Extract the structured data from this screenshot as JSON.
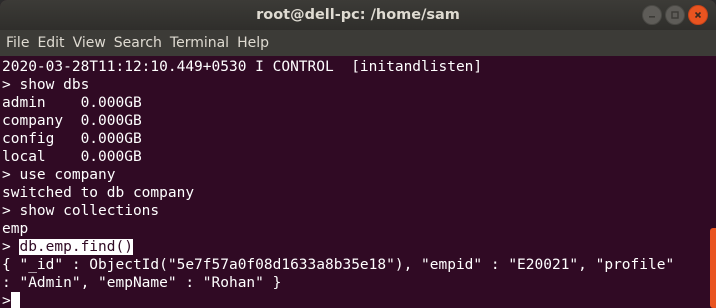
{
  "window": {
    "title": "root@dell-pc: /home/sam",
    "buttons": {
      "minimize": "minimize-icon",
      "maximize": "maximize-icon",
      "close": "close-icon"
    }
  },
  "menu": [
    "File",
    "Edit",
    "View",
    "Search",
    "Terminal",
    "Help"
  ],
  "terminal": {
    "lines": [
      "2020-03-28T11:12:10.449+0530 I CONTROL  [initandlisten]",
      "> show dbs",
      "admin    0.000GB",
      "company  0.000GB",
      "config   0.000GB",
      "local    0.000GB",
      "> use company",
      "switched to db company",
      "> show collections",
      "emp"
    ],
    "find_prompt": "> ",
    "find_command": "db.emp.find()",
    "result_line1": "{ \"_id\" : ObjectId(\"5e7f57a0f08d1633a8b35e18\"), \"empid\" : \"E20021\", \"profile\"",
    "result_line2": ": \"Admin\", \"empName\" : \"Rohan\" }",
    "final_prompt": ">"
  },
  "colors": {
    "terminal_bg": "#300a24",
    "text": "#ffffff",
    "accent": "#e95420",
    "titlebar": "#3c3b37"
  }
}
